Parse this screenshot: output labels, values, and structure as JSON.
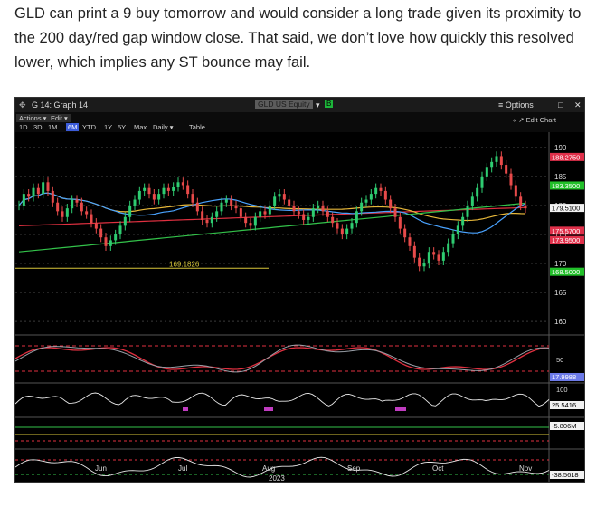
{
  "article": {
    "paragraph": "GLD can print a 9 buy tomorrow and would consider a long trade given its proximity to the 200 day/red gap window close. That said, we don’t love how quickly this resolved lower, which implies any ST bounce may fail."
  },
  "window": {
    "title": "G 14: Graph 14",
    "ticker": "GLD US Equity",
    "b_badge": "B",
    "options_label": "≡ Options",
    "menu": {
      "actions": "Actions ▾",
      "edit": "Edit ▾"
    },
    "ranges": [
      "1D",
      "3D",
      "1M",
      "6M",
      "YTD",
      "1Y",
      "5Y",
      "Max"
    ],
    "active_range": "6M",
    "frequency": "Daily ▾",
    "table": "Table",
    "edit_chart": "« ↗ Edit Chart",
    "colors": {
      "accent": "#3b5bd8",
      "bg": "#000000",
      "ticker_bg": "#5c5c5c",
      "badge": "#1db53a"
    }
  },
  "chart_data": {
    "type": "candlestick",
    "price_axis_ticks": [
      "190",
      "185",
      "180",
      "175",
      "170",
      "165",
      "160"
    ],
    "price_tags": [
      {
        "label": "188.2750",
        "color": "#e0304a"
      },
      {
        "label": "183.3500",
        "color": "#22c02a"
      },
      {
        "label": "179.5100",
        "color": "#f2f2f2"
      },
      {
        "label": "175.5700",
        "color": "#e0304a"
      },
      {
        "label": "173.9500",
        "color": "#e0304a"
      },
      {
        "label": "168.5000",
        "color": "#22c02a"
      }
    ],
    "support_level_label": "169.1826",
    "osc1_ticks": [
      "50"
    ],
    "osc1_tags": [
      {
        "label": "17.9988",
        "color": "#6c7ae8"
      }
    ],
    "osc2_ticks": [
      "100"
    ],
    "osc2_tags": [
      {
        "label": "25.5416",
        "color": "#f2f2f2"
      }
    ],
    "osc3_tags": [
      {
        "label": "-5.806M",
        "color": "#f2f2f2"
      }
    ],
    "osc4_tags": [
      {
        "label": "-38.5618",
        "color": "#f2f2f2"
      }
    ],
    "x_labels": [
      "Jun",
      "Jul",
      "Aug",
      "Sep",
      "Oct",
      "Nov"
    ],
    "year": "2023",
    "closes": [
      180,
      182,
      181.5,
      183,
      182,
      184,
      182.5,
      180.5,
      179,
      178,
      179.5,
      181,
      180.5,
      179,
      178.5,
      177,
      176,
      174.5,
      173,
      174,
      175,
      176.5,
      178,
      180,
      181,
      182.5,
      183,
      182,
      181,
      182,
      183,
      182.5,
      183.2,
      184,
      183.5,
      182,
      180.5,
      179,
      177.5,
      177,
      178,
      179,
      180.5,
      181,
      180,
      179.5,
      178,
      177,
      176.5,
      178,
      179,
      178.5,
      180,
      181.5,
      182,
      181,
      180,
      179,
      178.5,
      177.5,
      178,
      179.5,
      180,
      179,
      178,
      177,
      176,
      175,
      176,
      177,
      179,
      180.5,
      181,
      182,
      183,
      182.5,
      181,
      179.5,
      178,
      176,
      174.5,
      173,
      171,
      169.5,
      170,
      172,
      171.5,
      170.5,
      172,
      173.5,
      175,
      176.5,
      178,
      180,
      181.5,
      183,
      185,
      186.5,
      187.5,
      188.5,
      187,
      185.5,
      183.5,
      181.5,
      180,
      179.5
    ]
  }
}
